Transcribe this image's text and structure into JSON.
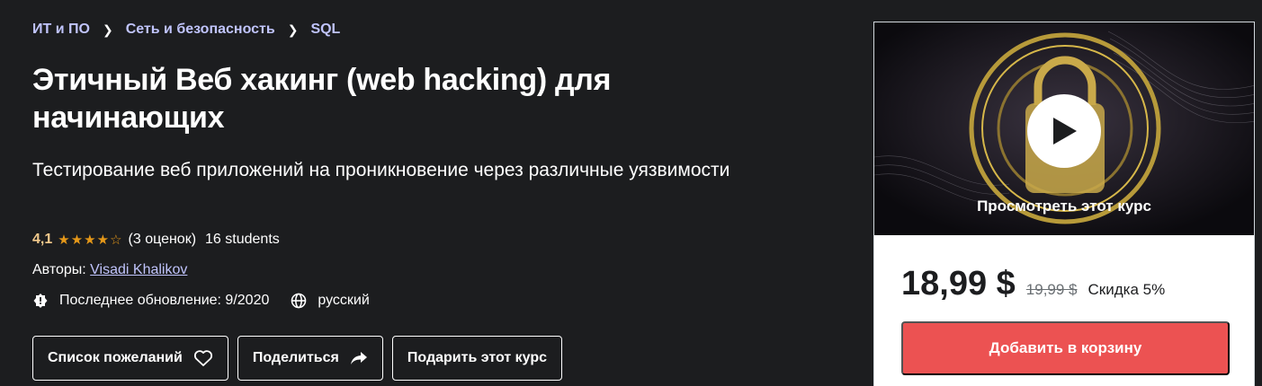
{
  "breadcrumb": [
    "ИТ и ПО",
    "Сеть и безопасность",
    "SQL"
  ],
  "course": {
    "title": "Этичный Веб хакинг (web hacking) для начинающих",
    "subtitle": "Тестирование веб приложений на проникновение через различные уязвимости",
    "rating": "4,1",
    "stars_filled": 4,
    "ratings_count": "(3 оценок)",
    "students": "16 students",
    "authors_label": "Авторы:",
    "author": "Visadi Khalikov",
    "last_update": "Последнее обновление: 9/2020",
    "language": "русский"
  },
  "actions": {
    "wishlist": "Список пожеланий",
    "share": "Поделиться",
    "gift": "Подарить этот курс"
  },
  "sidebar": {
    "preview_label": "Просмотреть этот курс",
    "price": "18,99 $",
    "old_price": "19,99 $",
    "discount": "Скидка 5%",
    "add_to_cart": "Добавить в корзину"
  },
  "colors": {
    "background": "#1c1d1f",
    "link": "#c0c4fc",
    "rating": "#f3ca8c",
    "star": "#e59819",
    "cart_button": "#ec5252"
  },
  "icons": {
    "rating": "star-icon",
    "update": "badge-alert-icon",
    "language": "globe-icon",
    "wishlist": "heart-icon",
    "share": "share-arrow-icon",
    "preview": "play-icon"
  }
}
